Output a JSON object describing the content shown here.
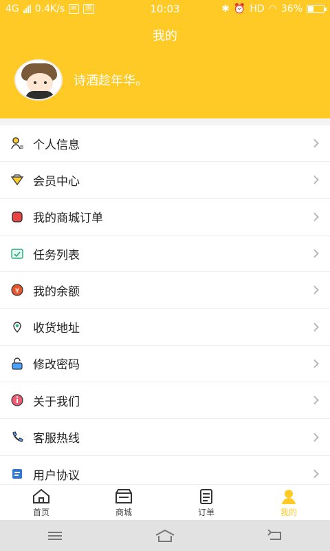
{
  "status_bar": {
    "network": "4G",
    "speed": "0.4K/s",
    "badge": "测",
    "time": "10:03",
    "hd": "HD",
    "battery": "36%",
    "battery_level": 0.36
  },
  "header": {
    "title": "我的",
    "username": "诗酒趁年华。"
  },
  "menu": {
    "items": [
      {
        "label": "个人信息",
        "icon": "user-info-icon"
      },
      {
        "label": "会员中心",
        "icon": "diamond-icon"
      },
      {
        "label": "我的商城订单",
        "icon": "order-icon"
      },
      {
        "label": "任务列表",
        "icon": "task-icon"
      },
      {
        "label": "我的余额",
        "icon": "balance-icon"
      },
      {
        "label": "收货地址",
        "icon": "location-icon"
      },
      {
        "label": "修改密码",
        "icon": "lock-icon"
      },
      {
        "label": "关于我们",
        "icon": "info-icon"
      },
      {
        "label": "客服热线",
        "icon": "phone-icon"
      },
      {
        "label": "用户协议",
        "icon": "agreement-icon"
      }
    ]
  },
  "tabbar": {
    "tabs": [
      {
        "label": "首页",
        "icon": "home-icon"
      },
      {
        "label": "商城",
        "icon": "store-icon"
      },
      {
        "label": "订单",
        "icon": "orders-icon"
      },
      {
        "label": "我的",
        "icon": "profile-icon"
      }
    ],
    "active_color": "#ffc926"
  },
  "system_nav": [
    "menu-icon",
    "home-nav-icon",
    "back-icon"
  ]
}
